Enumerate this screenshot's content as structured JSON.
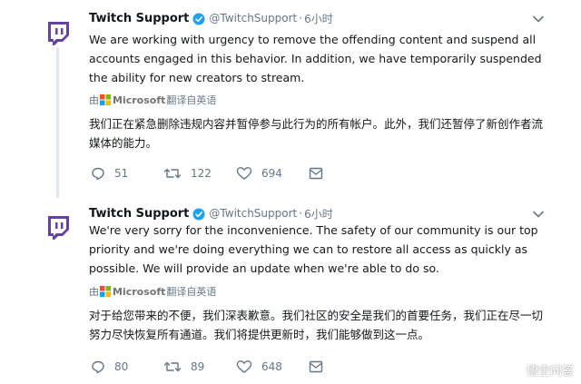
{
  "tweets": [
    {
      "name": "Twitch Support",
      "handle": "@TwitchSupport",
      "separator": "·",
      "time": "6小时",
      "text": "We are working with urgency to remove the offending content and suspend all accounts engaged in this behavior. In addition, we have temporarily suspended the ability for new creators to stream.",
      "translated_prefix": "由",
      "translated_brand": "Microsoft",
      "translated_suffix": "翻译自英语",
      "translation": "我们正在紧急删除违规内容并暂停参与此行为的所有帐户。此外，我们还暂停了新创作者流媒体的能力。",
      "replies": "51",
      "retweets": "122",
      "likes": "694"
    },
    {
      "name": "Twitch Support",
      "handle": "@TwitchSupport",
      "separator": "·",
      "time": "6小时",
      "text": "We're very sorry for the inconvenience. The safety of our community is our top priority and we're doing everything we can to restore all access as quickly as possible. We will provide an update when we're able to do so.",
      "translated_prefix": "由",
      "translated_brand": "Microsoft",
      "translated_suffix": "翻译自英语",
      "translation": "对于给您带来的不便，我们深表歉意。我们社区的安全是我们的首要任务，我们正在尽一切努力尽快恢复所有通道。我们将提供更新时，我们能够做到这一点。",
      "replies": "80",
      "retweets": "89",
      "likes": "648"
    }
  ],
  "colors": {
    "twitch_purple": "#6441a4",
    "verified_blue": "#1da1f2",
    "muted_text": "#657786",
    "thread_line": "#e1e8ed"
  },
  "icons": [
    "twitch-logo-icon",
    "verified-badge-icon",
    "chevron-down-icon",
    "reply-icon",
    "retweet-icon",
    "like-icon",
    "message-icon",
    "microsoft-logo-icon"
  ],
  "watermark": "悟空问答"
}
